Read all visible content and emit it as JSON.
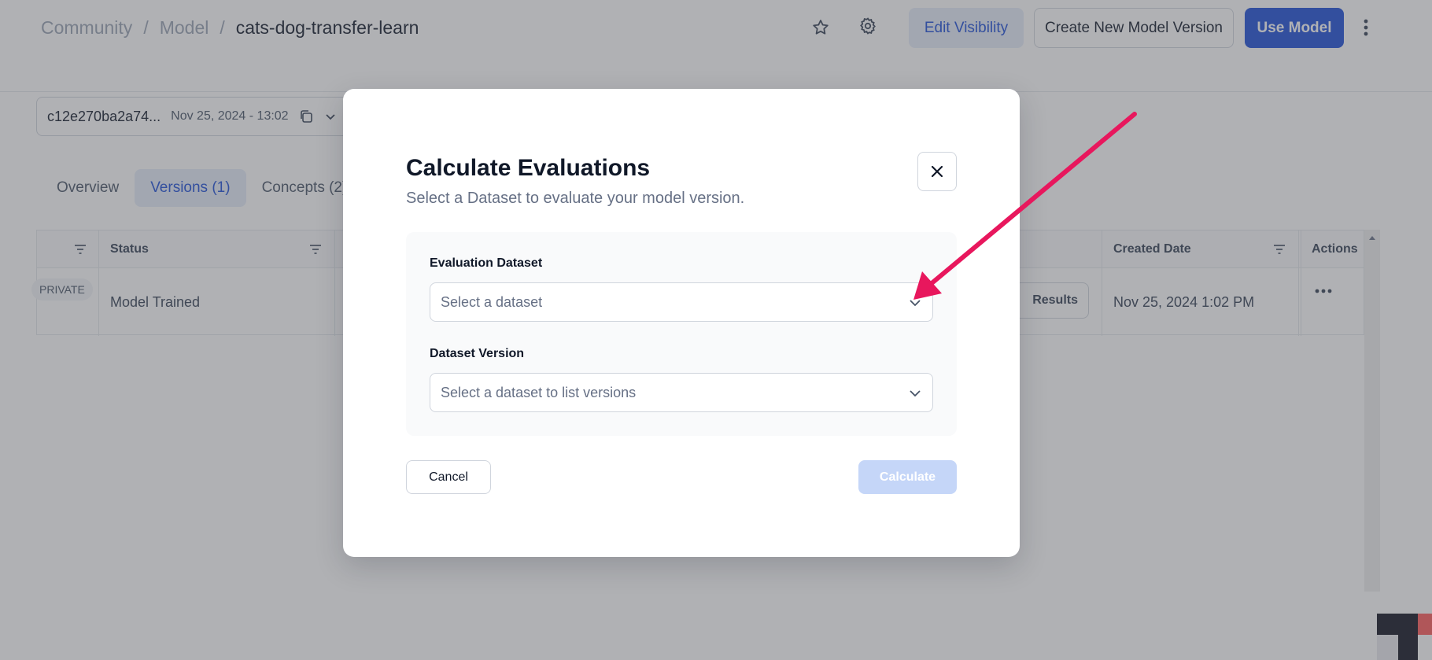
{
  "breadcrumb": {
    "community": "Community",
    "model": "Model",
    "separator": "/",
    "current": "cats-dog-transfer-learn"
  },
  "header": {
    "star_icon": "star-icon",
    "settings_icon": "gear-icon",
    "edit_visibility_label": "Edit Visibility",
    "create_version_label": "Create New Model Version",
    "use_model_label": "Use Model",
    "more_icon": "kebab-icon"
  },
  "version_selector": {
    "id": "c12e270ba2a74...",
    "date": "Nov 25, 2024 - 13:02"
  },
  "tabs": [
    {
      "label": "Overview",
      "active": false
    },
    {
      "label": "Versions (1)",
      "active": true
    },
    {
      "label": "Concepts (2)",
      "active": false
    }
  ],
  "table": {
    "headers": {
      "status": "Status",
      "created_date": "Created Date",
      "actions": "Actions"
    },
    "row": {
      "visibility": "PRIVATE",
      "status": "Model Trained",
      "results_label": "Results",
      "created_date": "Nov 25, 2024 1:02 PM"
    }
  },
  "modal": {
    "title": "Calculate Evaluations",
    "subtitle": "Select a Dataset to evaluate your model version.",
    "evaluation_dataset_label": "Evaluation Dataset",
    "evaluation_dataset_placeholder": "Select a dataset",
    "dataset_version_label": "Dataset Version",
    "dataset_version_placeholder": "Select a dataset to list versions",
    "cancel_label": "Cancel",
    "calculate_label": "Calculate"
  },
  "colors": {
    "primary": "#1d4ed8",
    "primary_soft": "#e6edfa",
    "disabled_button": "#c5d6f8",
    "annotation_arrow": "#e8175d",
    "overlay": "rgba(80,82,88,0.45)"
  }
}
